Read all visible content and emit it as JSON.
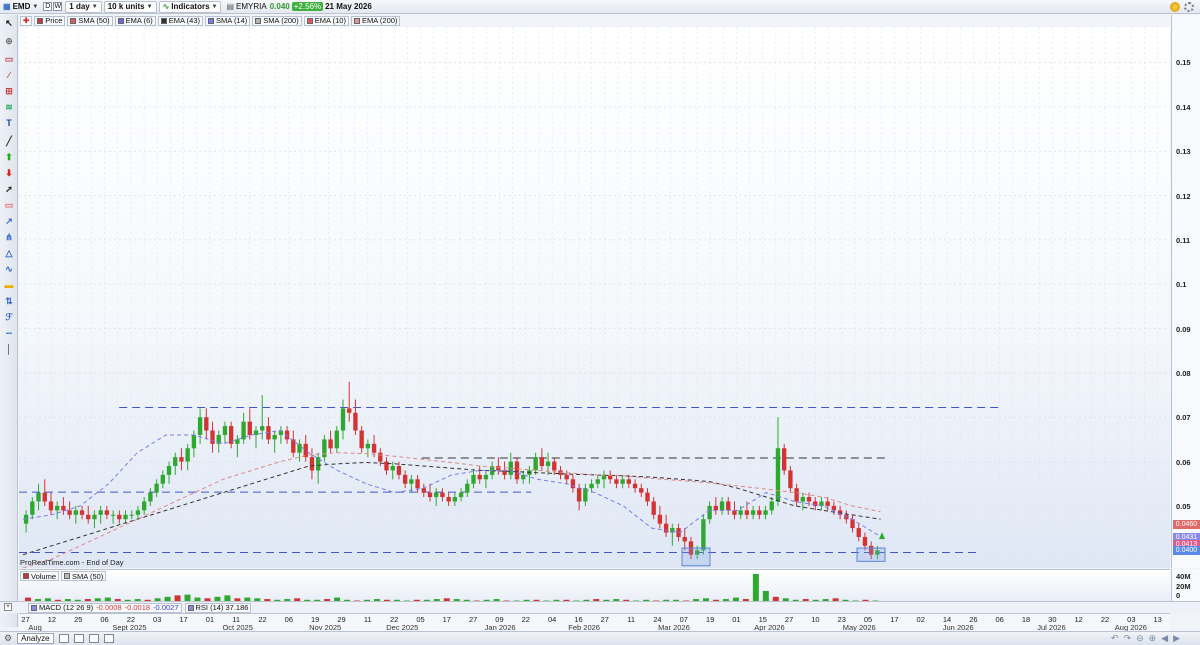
{
  "toolbar": {
    "symbol": "EMD",
    "d_label": "D",
    "w_label": "W",
    "timeframe": "1 day",
    "units": "10 k units",
    "indicators_label": "Indicators",
    "instrument": "EMYRIA",
    "last_price": "0.040",
    "change_pct": "+2.56%",
    "date": "21 May 2026"
  },
  "legend": [
    {
      "label": "Price",
      "color": "#c04040"
    },
    {
      "label": "SMA (50)",
      "color": "#e05a5a"
    },
    {
      "label": "EMA (6)",
      "color": "#6a6af0"
    },
    {
      "label": "EMA (43)",
      "color": "#333333"
    },
    {
      "label": "SMA (14)",
      "color": "#7a7af0"
    },
    {
      "label": "SMA (200)",
      "color": "#b5b5b5"
    },
    {
      "label": "EMA (10)",
      "color": "#e05a5a"
    },
    {
      "label": "EMA (200)",
      "color": "#e89090"
    }
  ],
  "price_axis": {
    "ticks": [
      "0.15",
      "0.14",
      "0.13",
      "0.12",
      "0.11",
      "0.1",
      "0.09",
      "0.08",
      "0.07",
      "0.06",
      "0.05"
    ],
    "ylim": [
      0.036,
      0.158
    ],
    "markers": [
      {
        "label": "0.0460",
        "value": 0.046,
        "color": "#e06a6a"
      },
      {
        "label": "0.0431",
        "value": 0.0431,
        "color": "#8a8ae8"
      },
      {
        "label": "0.0413",
        "value": 0.0413,
        "color": "#e05a8a"
      },
      {
        "label": "0.0400",
        "value": 0.04,
        "color": "#5a8ae8"
      }
    ]
  },
  "source_label": "ProRealTime.com - End of Day",
  "volume_panel": {
    "legend": [
      "Volume",
      "SMA (50)"
    ],
    "ticks": [
      "40M",
      "20M",
      "0"
    ]
  },
  "macd_label": "MACD (12 26 9)",
  "macd_values": [
    "-0.0008",
    "-0.0018",
    "-0.0027"
  ],
  "rsi_label": "RSI (14) 37.186",
  "x_axis": {
    "day_ticks": [
      "27",
      "04",
      "11",
      "18",
      "25",
      "02",
      "09",
      "16",
      "23",
      "30",
      "06",
      "13",
      "20",
      "27",
      "03",
      "10",
      "17",
      "24",
      "01",
      "08",
      "15",
      "22",
      "29",
      "05",
      "12",
      "19",
      "26",
      "03",
      "10",
      "17",
      "24",
      "31",
      "07",
      "14",
      "21",
      "28",
      "04",
      "11",
      "18",
      "25",
      "02",
      "09",
      "16",
      "23",
      "30",
      "06",
      "13",
      "20",
      "27",
      "03",
      "10",
      "17",
      "24",
      "01",
      "08",
      "15",
      "22",
      "29",
      "06",
      "13",
      "20",
      "27",
      "03",
      "10",
      "17",
      "24",
      "31"
    ],
    "day_ticks_visible": [
      "27",
      "04",
      "12",
      "18",
      "25",
      "30",
      "06",
      "13",
      "22",
      "28",
      "03",
      "10",
      "17",
      "24",
      "01",
      "06",
      "11",
      "17",
      "22",
      "28",
      "06",
      "13",
      "19",
      "23",
      "29",
      "05",
      "11",
      "16",
      "22",
      "27",
      "05",
      "11",
      "17",
      "23",
      "27",
      "02",
      "09",
      "16",
      "22",
      "27",
      "04",
      "11",
      "16",
      "21",
      "27",
      "04",
      "11",
      "18",
      "24",
      "30",
      "07",
      "13",
      "19",
      "25",
      "01",
      "08",
      "15",
      "21",
      "27",
      "03",
      "10",
      "16",
      "23",
      "28",
      "05",
      "11",
      "17",
      "24",
      "02",
      "08",
      "14",
      "20",
      "26",
      "01",
      "06",
      "12",
      "18",
      "24",
      "30",
      "06",
      "12",
      "16",
      "22",
      "28",
      "03",
      "07",
      "13"
    ],
    "months": [
      {
        "label": "Aug",
        "pos": 0.014
      },
      {
        "label": "Sept 2025",
        "pos": 0.096
      },
      {
        "label": "Oct 2025",
        "pos": 0.19
      },
      {
        "label": "Nov 2025",
        "pos": 0.266
      },
      {
        "label": "Dec 2025",
        "pos": 0.333
      },
      {
        "label": "Jan 2026",
        "pos": 0.418
      },
      {
        "label": "Feb 2026",
        "pos": 0.491
      },
      {
        "label": "Mar 2026",
        "pos": 0.569
      },
      {
        "label": "Apr 2026",
        "pos": 0.652
      },
      {
        "label": "May 2026",
        "pos": 0.73
      },
      {
        "label": "Jun 2026",
        "pos": 0.816
      },
      {
        "label": "Jul 2026",
        "pos": 0.897
      },
      {
        "label": "Aug 2026",
        "pos": 0.966
      }
    ]
  },
  "bottom_bar": {
    "analyze_label": "Analyze"
  },
  "chart_data": {
    "type": "candlestick",
    "ylim": [
      0.036,
      0.158
    ],
    "candles": [
      [
        0.046,
        0.049,
        0.044,
        0.048
      ],
      [
        0.048,
        0.052,
        0.047,
        0.051
      ],
      [
        0.051,
        0.055,
        0.049,
        0.053
      ],
      [
        0.053,
        0.056,
        0.05,
        0.051
      ],
      [
        0.051,
        0.053,
        0.048,
        0.049
      ],
      [
        0.049,
        0.051,
        0.047,
        0.05
      ],
      [
        0.05,
        0.052,
        0.048,
        0.049
      ],
      [
        0.049,
        0.051,
        0.047,
        0.048
      ],
      [
        0.048,
        0.05,
        0.046,
        0.049
      ],
      [
        0.049,
        0.05,
        0.047,
        0.048
      ],
      [
        0.048,
        0.05,
        0.046,
        0.047
      ],
      [
        0.047,
        0.049,
        0.045,
        0.048
      ],
      [
        0.048,
        0.05,
        0.046,
        0.049
      ],
      [
        0.049,
        0.05,
        0.047,
        0.048
      ],
      [
        0.048,
        0.049,
        0.046,
        0.048
      ],
      [
        0.048,
        0.049,
        0.046,
        0.047
      ],
      [
        0.047,
        0.049,
        0.046,
        0.048
      ],
      [
        0.048,
        0.049,
        0.047,
        0.048
      ],
      [
        0.048,
        0.05,
        0.047,
        0.049
      ],
      [
        0.049,
        0.052,
        0.048,
        0.051
      ],
      [
        0.051,
        0.054,
        0.05,
        0.053
      ],
      [
        0.053,
        0.056,
        0.052,
        0.055
      ],
      [
        0.055,
        0.058,
        0.054,
        0.057
      ],
      [
        0.057,
        0.06,
        0.055,
        0.059
      ],
      [
        0.059,
        0.062,
        0.057,
        0.061
      ],
      [
        0.061,
        0.063,
        0.058,
        0.06
      ],
      [
        0.06,
        0.064,
        0.058,
        0.063
      ],
      [
        0.063,
        0.067,
        0.061,
        0.066
      ],
      [
        0.066,
        0.072,
        0.064,
        0.07
      ],
      [
        0.07,
        0.072,
        0.065,
        0.067
      ],
      [
        0.067,
        0.069,
        0.062,
        0.064
      ],
      [
        0.064,
        0.067,
        0.062,
        0.066
      ],
      [
        0.066,
        0.069,
        0.064,
        0.068
      ],
      [
        0.068,
        0.069,
        0.063,
        0.064
      ],
      [
        0.064,
        0.066,
        0.061,
        0.065
      ],
      [
        0.065,
        0.071,
        0.064,
        0.069
      ],
      [
        0.069,
        0.072,
        0.065,
        0.066
      ],
      [
        0.066,
        0.068,
        0.063,
        0.067
      ],
      [
        0.067,
        0.075,
        0.065,
        0.068
      ],
      [
        0.068,
        0.07,
        0.064,
        0.065
      ],
      [
        0.065,
        0.067,
        0.062,
        0.066
      ],
      [
        0.066,
        0.068,
        0.064,
        0.067
      ],
      [
        0.067,
        0.068,
        0.064,
        0.065
      ],
      [
        0.065,
        0.067,
        0.061,
        0.062
      ],
      [
        0.062,
        0.065,
        0.06,
        0.064
      ],
      [
        0.064,
        0.066,
        0.06,
        0.061
      ],
      [
        0.061,
        0.063,
        0.056,
        0.058
      ],
      [
        0.058,
        0.062,
        0.055,
        0.061
      ],
      [
        0.061,
        0.066,
        0.06,
        0.065
      ],
      [
        0.065,
        0.067,
        0.062,
        0.063
      ],
      [
        0.063,
        0.068,
        0.062,
        0.067
      ],
      [
        0.067,
        0.074,
        0.065,
        0.072
      ],
      [
        0.072,
        0.078,
        0.069,
        0.071
      ],
      [
        0.071,
        0.074,
        0.066,
        0.067
      ],
      [
        0.067,
        0.068,
        0.062,
        0.063
      ],
      [
        0.063,
        0.065,
        0.061,
        0.064
      ],
      [
        0.064,
        0.066,
        0.061,
        0.062
      ],
      [
        0.062,
        0.063,
        0.059,
        0.06
      ],
      [
        0.06,
        0.061,
        0.057,
        0.058
      ],
      [
        0.058,
        0.06,
        0.056,
        0.059
      ],
      [
        0.059,
        0.06,
        0.056,
        0.057
      ],
      [
        0.057,
        0.058,
        0.054,
        0.055
      ],
      [
        0.055,
        0.057,
        0.053,
        0.056
      ],
      [
        0.056,
        0.057,
        0.053,
        0.054
      ],
      [
        0.054,
        0.055,
        0.052,
        0.053
      ],
      [
        0.053,
        0.055,
        0.051,
        0.052
      ],
      [
        0.052,
        0.054,
        0.05,
        0.053
      ],
      [
        0.053,
        0.054,
        0.051,
        0.052
      ],
      [
        0.052,
        0.053,
        0.05,
        0.051
      ],
      [
        0.051,
        0.053,
        0.05,
        0.052
      ],
      [
        0.052,
        0.054,
        0.051,
        0.053
      ],
      [
        0.053,
        0.056,
        0.052,
        0.055
      ],
      [
        0.055,
        0.058,
        0.054,
        0.057
      ],
      [
        0.057,
        0.059,
        0.055,
        0.056
      ],
      [
        0.056,
        0.058,
        0.054,
        0.057
      ],
      [
        0.057,
        0.06,
        0.056,
        0.059
      ],
      [
        0.059,
        0.061,
        0.057,
        0.058
      ],
      [
        0.058,
        0.06,
        0.056,
        0.057
      ],
      [
        0.057,
        0.062,
        0.056,
        0.06
      ],
      [
        0.06,
        0.061,
        0.055,
        0.056
      ],
      [
        0.056,
        0.058,
        0.055,
        0.057
      ],
      [
        0.057,
        0.059,
        0.055,
        0.058
      ],
      [
        0.058,
        0.062,
        0.057,
        0.061
      ],
      [
        0.061,
        0.063,
        0.058,
        0.059
      ],
      [
        0.059,
        0.062,
        0.057,
        0.06
      ],
      [
        0.06,
        0.061,
        0.057,
        0.058
      ],
      [
        0.058,
        0.059,
        0.056,
        0.057
      ],
      [
        0.057,
        0.058,
        0.055,
        0.056
      ],
      [
        0.056,
        0.057,
        0.053,
        0.054
      ],
      [
        0.054,
        0.055,
        0.049,
        0.051
      ],
      [
        0.051,
        0.055,
        0.05,
        0.054
      ],
      [
        0.054,
        0.056,
        0.053,
        0.055
      ],
      [
        0.055,
        0.057,
        0.054,
        0.056
      ],
      [
        0.056,
        0.058,
        0.054,
        0.057
      ],
      [
        0.057,
        0.058,
        0.055,
        0.056
      ],
      [
        0.056,
        0.057,
        0.054,
        0.055
      ],
      [
        0.055,
        0.057,
        0.054,
        0.056
      ],
      [
        0.056,
        0.057,
        0.054,
        0.055
      ],
      [
        0.055,
        0.056,
        0.053,
        0.054
      ],
      [
        0.054,
        0.055,
        0.052,
        0.053
      ],
      [
        0.053,
        0.054,
        0.05,
        0.051
      ],
      [
        0.051,
        0.052,
        0.047,
        0.048
      ],
      [
        0.048,
        0.05,
        0.045,
        0.046
      ],
      [
        0.046,
        0.048,
        0.043,
        0.044
      ],
      [
        0.044,
        0.046,
        0.041,
        0.045
      ],
      [
        0.045,
        0.046,
        0.042,
        0.043
      ],
      [
        0.043,
        0.045,
        0.04,
        0.042
      ],
      [
        0.042,
        0.043,
        0.038,
        0.039
      ],
      [
        0.039,
        0.041,
        0.038,
        0.04
      ],
      [
        0.04,
        0.048,
        0.039,
        0.047
      ],
      [
        0.047,
        0.051,
        0.046,
        0.05
      ],
      [
        0.05,
        0.052,
        0.048,
        0.049
      ],
      [
        0.049,
        0.052,
        0.048,
        0.051
      ],
      [
        0.051,
        0.052,
        0.048,
        0.049
      ],
      [
        0.049,
        0.051,
        0.047,
        0.048
      ],
      [
        0.048,
        0.05,
        0.047,
        0.049
      ],
      [
        0.049,
        0.051,
        0.047,
        0.048
      ],
      [
        0.048,
        0.05,
        0.047,
        0.049
      ],
      [
        0.049,
        0.05,
        0.047,
        0.048
      ],
      [
        0.048,
        0.05,
        0.047,
        0.049
      ],
      [
        0.049,
        0.052,
        0.048,
        0.051
      ],
      [
        0.051,
        0.07,
        0.05,
        0.063
      ],
      [
        0.063,
        0.064,
        0.057,
        0.058
      ],
      [
        0.058,
        0.059,
        0.053,
        0.054
      ],
      [
        0.054,
        0.055,
        0.05,
        0.051
      ],
      [
        0.051,
        0.053,
        0.049,
        0.052
      ],
      [
        0.052,
        0.053,
        0.05,
        0.051
      ],
      [
        0.051,
        0.052,
        0.049,
        0.05
      ],
      [
        0.05,
        0.052,
        0.049,
        0.051
      ],
      [
        0.051,
        0.052,
        0.049,
        0.05
      ],
      [
        0.05,
        0.051,
        0.048,
        0.049
      ],
      [
        0.049,
        0.05,
        0.047,
        0.048
      ],
      [
        0.048,
        0.049,
        0.046,
        0.047
      ],
      [
        0.047,
        0.048,
        0.044,
        0.045
      ],
      [
        0.045,
        0.046,
        0.042,
        0.043
      ],
      [
        0.043,
        0.044,
        0.04,
        0.041
      ],
      [
        0.041,
        0.042,
        0.038,
        0.039
      ],
      [
        0.039,
        0.041,
        0.038,
        0.04
      ]
    ],
    "moving_averages": [
      {
        "name": "EMA (43)",
        "color": "#333333",
        "values": [
          0.039,
          0.041,
          0.043,
          0.045,
          0.047,
          0.049,
          0.051,
          0.053,
          0.055,
          0.057,
          0.059,
          0.0595,
          0.0598,
          0.0595,
          0.059,
          0.0585,
          0.058,
          0.0578,
          0.0575,
          0.0572,
          0.057,
          0.0568,
          0.0565,
          0.056,
          0.0555,
          0.054,
          0.052,
          0.05,
          0.049,
          0.048,
          0.047
        ]
      },
      {
        "name": "EMA (200)",
        "color": "#e08888",
        "values": [
          0.036,
          0.038,
          0.041,
          0.044,
          0.047,
          0.05,
          0.053,
          0.056,
          0.058,
          0.06,
          0.0615,
          0.062,
          0.0618,
          0.0612,
          0.0605,
          0.0598,
          0.059,
          0.0585,
          0.058,
          0.0575,
          0.057,
          0.0568,
          0.0562,
          0.0557,
          0.0552,
          0.0545,
          0.0538,
          0.053,
          0.052,
          0.05,
          0.0487
        ]
      },
      {
        "name": "SMA (14)",
        "color": "#7a7af0",
        "values": [
          0.047,
          0.048,
          0.05,
          0.055,
          0.062,
          0.066,
          0.066,
          0.064,
          0.066,
          0.067,
          0.062,
          0.058,
          0.055,
          0.053,
          0.054,
          0.057,
          0.058,
          0.058,
          0.056,
          0.055,
          0.053,
          0.05,
          0.045,
          0.044,
          0.049,
          0.049,
          0.053,
          0.051,
          0.05,
          0.047,
          0.0431
        ]
      }
    ],
    "hlines": [
      {
        "value": 0.0722,
        "color": "#4455cc",
        "x1": 0.087,
        "x2": 0.853
      },
      {
        "value": 0.0608,
        "color": "#333333",
        "x1": 0.35,
        "x2": 0.755
      },
      {
        "value": 0.0531,
        "color": "#4455cc",
        "x1": 0.0,
        "x2": 0.445
      },
      {
        "value": 0.0395,
        "color": "#4455cc",
        "x1": 0.0,
        "x2": 0.835
      }
    ],
    "volume": [
      0.6,
      0.4,
      0.5,
      0.3,
      0.4,
      0.3,
      0.4,
      0.5,
      0.6,
      0.4,
      0.3,
      0.4,
      0.3,
      0.5,
      0.7,
      0.9,
      1.0,
      0.6,
      0.5,
      0.7,
      0.9,
      0.5,
      0.6,
      0.5,
      0.4,
      0.3,
      0.4,
      0.5,
      0.3,
      0.3,
      0.4,
      0.6,
      0.3,
      0.2,
      0.3,
      0.4,
      0.3,
      0.3,
      0.2,
      0.3,
      0.3,
      0.4,
      0.5,
      0.4,
      0.3,
      0.2,
      0.3,
      0.4,
      0.2,
      0.2,
      0.3,
      0.3,
      0.2,
      0.3,
      0.3,
      0.2,
      0.3,
      0.4,
      0.3,
      0.4,
      0.3,
      0.2,
      0.3,
      0.2,
      0.3,
      0.3,
      0.2,
      0.4,
      0.5,
      0.3,
      0.4,
      0.6,
      0.4,
      3.8,
      1.5,
      0.7,
      0.5,
      0.3,
      0.4,
      0.3,
      0.4,
      0.5,
      0.3,
      0.2,
      0.3,
      0.2
    ]
  }
}
